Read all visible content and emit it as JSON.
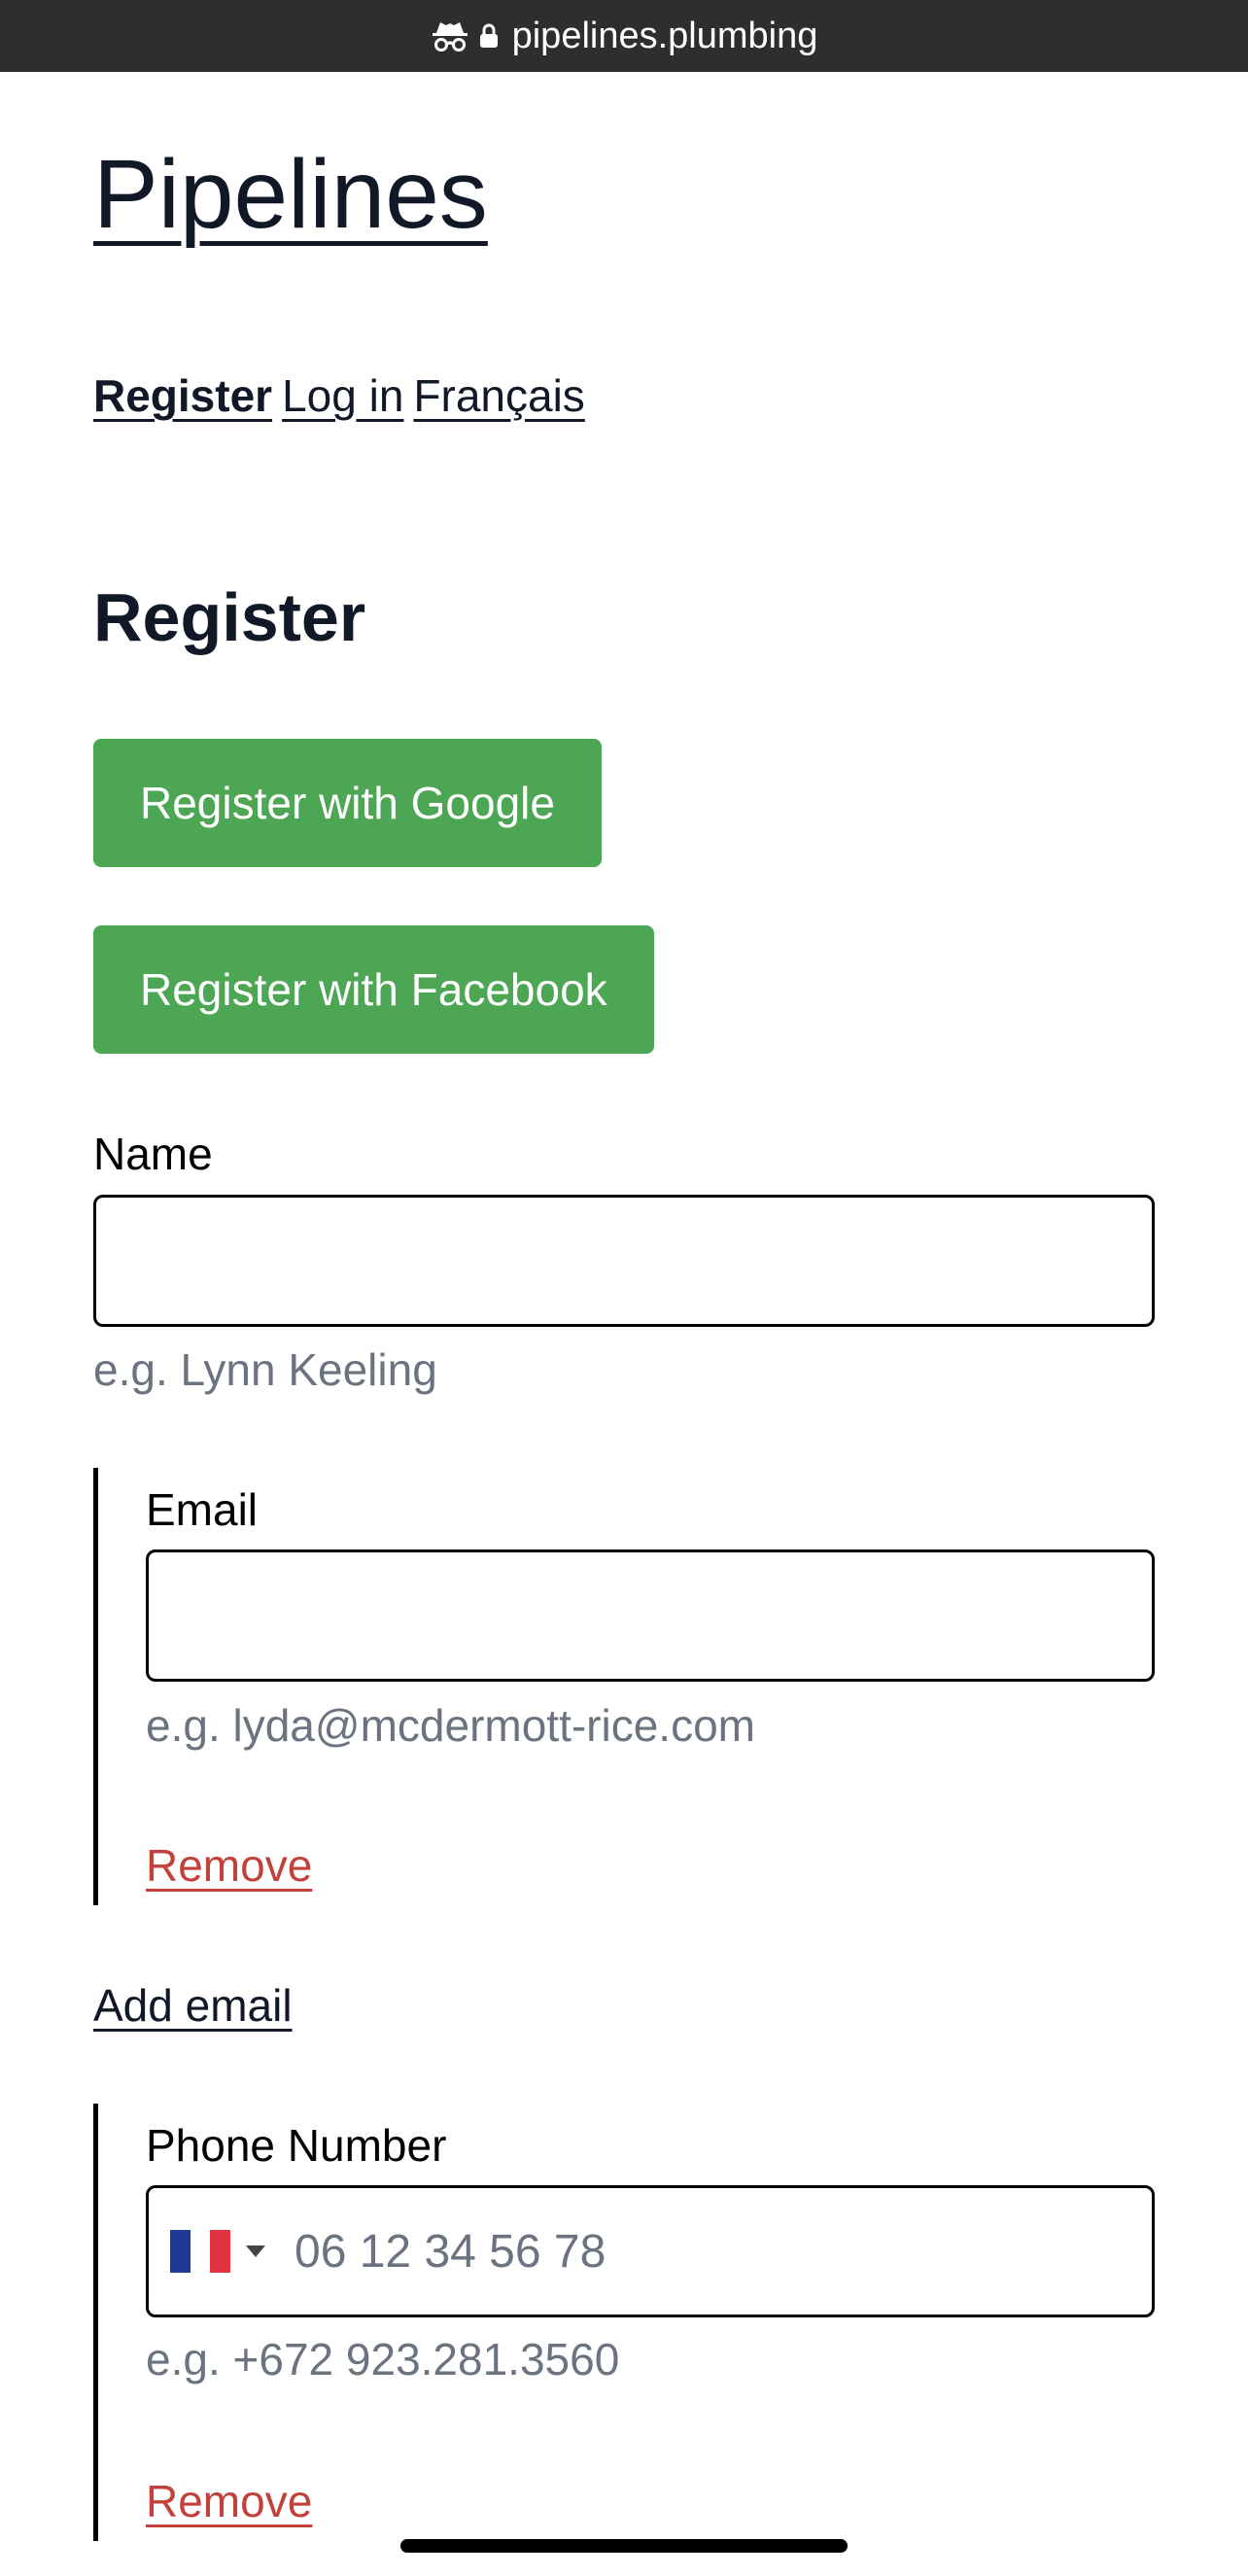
{
  "browser": {
    "url": "pipelines.plumbing"
  },
  "site": {
    "title": "Pipelines"
  },
  "nav": {
    "register": "Register",
    "login": "Log in",
    "language": "Français"
  },
  "page": {
    "heading": "Register"
  },
  "buttons": {
    "google": "Register with Google",
    "facebook": "Register with Facebook"
  },
  "form": {
    "name": {
      "label": "Name",
      "value": "",
      "hint": "e.g. Lynn Keeling"
    },
    "email": {
      "label": "Email",
      "value": "",
      "hint": "e.g. lyda@mcdermott-rice.com",
      "remove": "Remove"
    },
    "add_email": "Add email",
    "phone": {
      "label": "Phone Number",
      "placeholder": "06 12 34 56 78",
      "country": "France",
      "hint": "e.g. +672 923.281.3560",
      "remove": "Remove"
    }
  },
  "colors": {
    "accent": "#4ca653",
    "danger": "#c2413b",
    "hint": "#6b7280",
    "text": "#111827"
  }
}
